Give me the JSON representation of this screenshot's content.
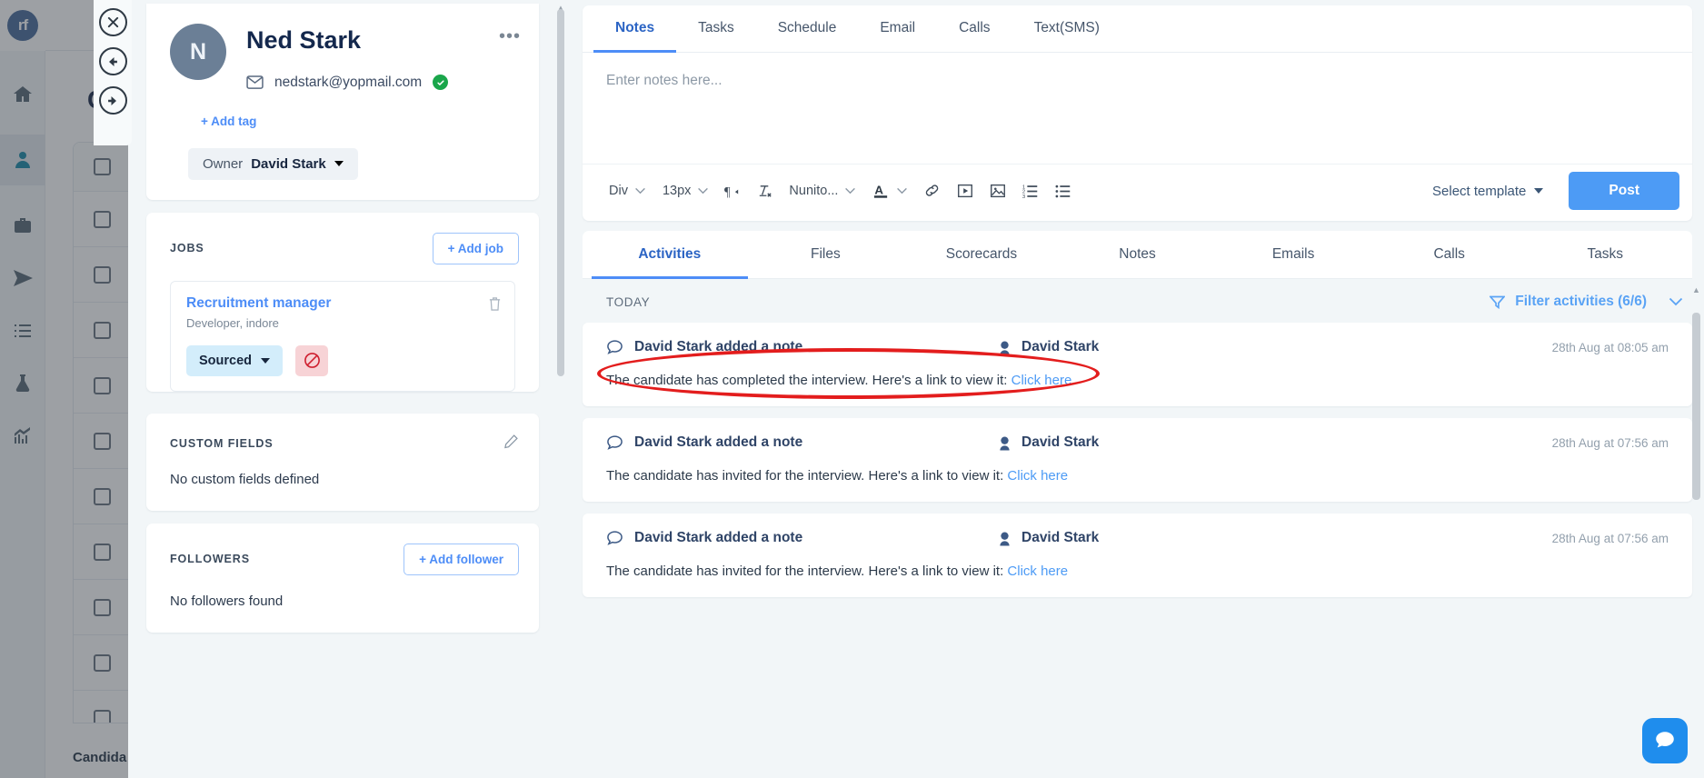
{
  "background": {
    "logo_text": "rf",
    "page_title": "C",
    "footer_label": "Candida",
    "nav_icons": [
      "home-icon",
      "contacts-icon",
      "briefcase-icon",
      "send-icon",
      "tasks-icon",
      "flask-icon",
      "reports-icon"
    ],
    "row_avatar_colors": [
      "",
      "#b4502a",
      "#2e77bb",
      "#2d3c52",
      "#d09a12",
      "#6a2fa8",
      "#c33718",
      "#b4502a",
      "#2e77bb",
      "#b4502a",
      "#2e77bb"
    ]
  },
  "float_nav": {
    "close_label": "✕",
    "prev_label": "←",
    "next_label": "→"
  },
  "candidate": {
    "avatar_initial": "N",
    "name": "Ned Stark",
    "email": "nedstark@yopmail.com",
    "email_verified": true,
    "more_label": "•••",
    "add_tag_label": "+ Add tag",
    "owner_label": "Owner",
    "owner_name": "David Stark"
  },
  "jobs": {
    "section_title": "JOBS",
    "add_job_label": "+ Add job",
    "items": [
      {
        "title": "Recruitment manager",
        "subtitle": "Developer, indore",
        "stage": "Sourced"
      }
    ]
  },
  "custom_fields": {
    "section_title": "CUSTOM FIELDS",
    "empty_text": "No custom fields defined"
  },
  "followers": {
    "section_title": "FOLLOWERS",
    "add_follower_label": "+ Add follower",
    "empty_text": "No followers found"
  },
  "composer": {
    "tabs": [
      {
        "label": "Notes",
        "active": true
      },
      {
        "label": "Tasks",
        "active": false
      },
      {
        "label": "Schedule",
        "active": false
      },
      {
        "label": "Email",
        "active": false
      },
      {
        "label": "Calls",
        "active": false
      },
      {
        "label": "Text(SMS)",
        "active": false
      }
    ],
    "placeholder": "Enter notes here...",
    "toolbar": {
      "block_format": "Div",
      "font_size": "13px",
      "font_family": "Nunito...",
      "paragraph_direction_icon": "paragraph-rtl-icon",
      "clear_format_icon": "clear-formatting-icon",
      "text_color_icon": "text-color-icon",
      "link_icon": "link-icon",
      "video_icon": "video-icon",
      "image_icon": "image-icon",
      "ordered_list_icon": "ordered-list-icon",
      "unordered_list_icon": "unordered-list-icon",
      "select_template_label": "Select template",
      "post_label": "Post"
    }
  },
  "activity_tabs": [
    {
      "label": "Activities",
      "active": true
    },
    {
      "label": "Files",
      "active": false
    },
    {
      "label": "Scorecards",
      "active": false
    },
    {
      "label": "Notes",
      "active": false
    },
    {
      "label": "Emails",
      "active": false
    },
    {
      "label": "Calls",
      "active": false
    },
    {
      "label": "Tasks",
      "active": false
    }
  ],
  "activities": {
    "group_label": "TODAY",
    "filter_label": "Filter activities (6/6)",
    "items": [
      {
        "title": "David Stark added a note",
        "user": "David Stark",
        "time": "28th Aug at 08:05 am",
        "body": "The candidate has completed the interview. Here's a link to view it:",
        "link_label": "Click here",
        "annotated": true
      },
      {
        "title": "David Stark added a note",
        "user": "David Stark",
        "time": "28th Aug at 07:56 am",
        "body": "The candidate has invited for the interview. Here's a link to view it:",
        "link_label": "Click here",
        "annotated": false
      },
      {
        "title": "David Stark added a note",
        "user": "David Stark",
        "time": "28th Aug at 07:56 am",
        "body": "The candidate has invited for the interview. Here's a link to view it:",
        "link_label": "Click here",
        "annotated": false
      }
    ]
  },
  "chat_widget": {
    "icon": "chat-icon"
  },
  "colors": {
    "accent_blue": "#4d8df7",
    "post_blue": "#4d9bf5",
    "annotation_red": "#e31d1d",
    "verified_green": "#1aa64b"
  }
}
